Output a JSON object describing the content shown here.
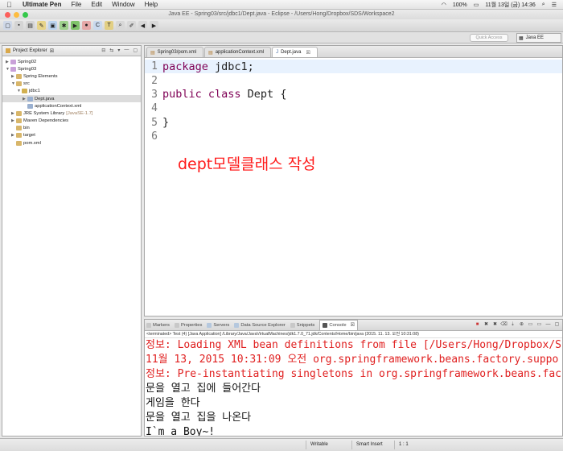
{
  "menubar": {
    "app": "Ultimate Pen",
    "menus": [
      "File",
      "Edit",
      "Window",
      "Help"
    ],
    "battery": "100%",
    "datetime": "11월 13일 (금)  14:36"
  },
  "window": {
    "title": "Java EE - Spring03/src/jdbc1/Dept.java - Eclipse - /Users/Hong/Dropbox/SDS/Workspace2"
  },
  "toolbar": {
    "quick_access": "Quick Access",
    "perspective": "Java EE"
  },
  "explorer": {
    "title": "Project Explorer",
    "items": [
      {
        "label": "Spring02",
        "level": 0,
        "expanded": false
      },
      {
        "label": "Spring03",
        "level": 0,
        "expanded": true
      },
      {
        "label": "Spring Elements",
        "level": 1,
        "expanded": false
      },
      {
        "label": "src",
        "level": 1,
        "expanded": true
      },
      {
        "label": "jdbc1",
        "level": 2,
        "expanded": true
      },
      {
        "label": "Dept.java",
        "level": 3,
        "expanded": false,
        "selected": true
      },
      {
        "label": "applicationContext.xml",
        "level": 3
      },
      {
        "label": "JRE System Library",
        "suffix": "[JavaSE-1.7]",
        "level": 1,
        "expanded": false
      },
      {
        "label": "Maven Dependencies",
        "level": 1,
        "expanded": false
      },
      {
        "label": "bin",
        "level": 1
      },
      {
        "label": "target",
        "level": 1,
        "expanded": false
      },
      {
        "label": "pom.xml",
        "level": 1
      }
    ]
  },
  "editor": {
    "tabs": [
      "Spring03/pom.xml",
      "applicationContext.xml",
      "Dept.java"
    ],
    "active_tab": 2,
    "lines": [
      {
        "n": "1",
        "kw": "package",
        "rest": " jdbc1;"
      },
      {
        "n": "2",
        "kw": "",
        "rest": ""
      },
      {
        "n": "3",
        "kw": "public class",
        "rest": " Dept {"
      },
      {
        "n": "4",
        "kw": "",
        "rest": ""
      },
      {
        "n": "5",
        "kw": "",
        "rest": "}"
      },
      {
        "n": "6",
        "kw": "",
        "rest": ""
      }
    ],
    "annotation": "dept모델클래스 작성"
  },
  "console": {
    "tabs": [
      "Markers",
      "Properties",
      "Servers",
      "Data Source Explorer",
      "Snippets",
      "Console"
    ],
    "active_tab": 5,
    "terminated": "<terminated> Test (4) [Java Application] /Library/Java/JavaVirtualMachines/jdk1.7.0_71.jdk/Contents/Home/bin/java (2015. 11. 13. 오전 10:31:08)",
    "lines": [
      {
        "text": "정보: Loading XML bean definitions from file [/Users/Hong/Dropbox/S",
        "color": "red"
      },
      {
        "text": "11월 13, 2015 10:31:09 오전 org.springframework.beans.factory.suppo",
        "color": "red"
      },
      {
        "text": "정보: Pre-instantiating singletons in org.springframework.beans.fac",
        "color": "red"
      },
      {
        "text": "문을 열고 집에 들어간다",
        "color": "black"
      },
      {
        "text": "게임을 한다",
        "color": "black"
      },
      {
        "text": "문을 열고 집을 나온다",
        "color": "black"
      },
      {
        "text": "I`m a Boy~!",
        "color": "black"
      }
    ]
  },
  "status": {
    "writable": "Writable",
    "insert": "Smart Insert",
    "position": "1 : 1"
  },
  "colors": {
    "accent_red": "#ff1a1a",
    "keyword": "#7f0055",
    "console_error": "#e02020"
  }
}
